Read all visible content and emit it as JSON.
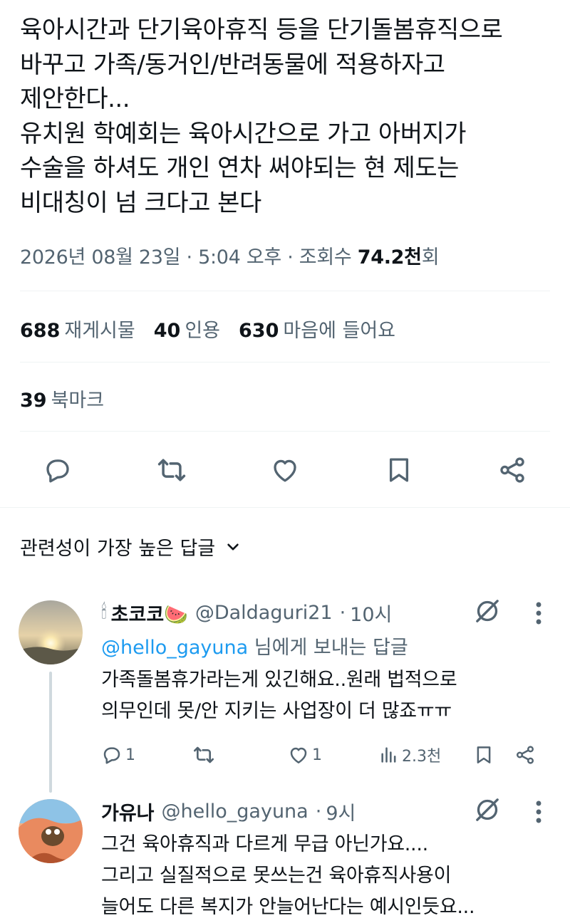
{
  "tweet": {
    "text": "육아시간과 단기육아휴직 등을 단기돌봄휴직으로\n바꾸고 가족/동거인/반려동물에 적용하자고\n제안한다...\n유치원 학예회는 육아시간으로 가고 아버지가\n수술을 하셔도 개인 연차 써야되는 현 제도는\n비대칭이 넘 크다고 본다",
    "date": "2026년 08월 23일",
    "time": "5:04 오후",
    "views_label": "조회수",
    "views_value": "74.2천",
    "views_suffix": "회",
    "separator": "·"
  },
  "stats": {
    "reposts_count": "688",
    "reposts_label": "재게시물",
    "quotes_count": "40",
    "quotes_label": "인용",
    "likes_count": "630",
    "likes_label": "마음에 들어요",
    "bookmarks_count": "39",
    "bookmarks_label": "북마크"
  },
  "actions": {
    "icons": [
      "reply-icon",
      "repost-icon",
      "like-icon",
      "bookmark-icon",
      "share-icon"
    ]
  },
  "replies_sort": {
    "label": "관련성이 가장 높은 답글"
  },
  "replies": [
    {
      "name": "초코코",
      "name_emoji_left": "🕯",
      "name_emoji_right": "🍉",
      "handle": "@Daldaguri21",
      "time": "10시",
      "reply_to_mention": "@hello_gayuna",
      "reply_to_suffix": " 님에게 보내는 답글",
      "text": "가족돌봄휴가라는게 있긴해요..원래 법적으로\n의무인데 못/안 지키는 사업장이 더 많죠ㅠㅠ",
      "reply_count": "1",
      "like_count": "1",
      "views": "2.3천"
    },
    {
      "name": "가유나",
      "handle": "@hello_gayuna",
      "time": "9시",
      "text": "그건 육아휴직과 다르게 무급 아닌가요....\n그리고 실질적으로 못쓰는건 육아휴직사용이\n늘어도 다른 복지가 안늘어난다는 예시인듯요..."
    }
  ],
  "colors": {
    "text": "#0f1419",
    "secondary": "#536471",
    "link": "#1d9bf0",
    "divider": "#eff3f4",
    "thread_line": "#cfd9de"
  }
}
